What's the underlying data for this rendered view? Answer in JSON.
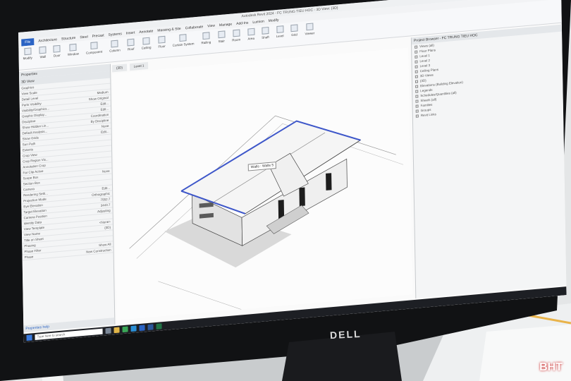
{
  "app": {
    "title": "Autodesk Revit 2024 - FC TRUNG TIEU HOC - 3D View: {3D}"
  },
  "menu": [
    "File",
    "Architecture",
    "Structure",
    "Steel",
    "Precast",
    "Systems",
    "Insert",
    "Annotate",
    "Massing & Site",
    "Collaborate",
    "View",
    "Manage",
    "Add-Ins",
    "Lumion",
    "Modify"
  ],
  "ribbon": [
    "Modify",
    "Wall",
    "Door",
    "Window",
    "Component",
    "Column",
    "Roof",
    "Ceiling",
    "Floor",
    "Curtain System",
    "Curtain Grid",
    "Mullion",
    "Railing",
    "Ramp",
    "Stair",
    "Model Text",
    "Model Line",
    "Model Group",
    "Room",
    "Room Separator",
    "Tag Room",
    "Area",
    "Area Boundary",
    "Tag Area",
    "By Face",
    "Shaft",
    "Wall",
    "Vertical",
    "Dormer",
    "Level",
    "Grid",
    "Set",
    "Show",
    "Ref Plane",
    "Viewer"
  ],
  "properties": {
    "header": "Properties",
    "type": "3D View",
    "rows": [
      [
        "Graphics",
        ""
      ],
      [
        "View Scale",
        ""
      ],
      [
        "Detail Level",
        "Medium"
      ],
      [
        "Parts Visibility",
        "Show Original"
      ],
      [
        "Visibility/Graphics...",
        "Edit..."
      ],
      [
        "Graphic Display...",
        "Edit..."
      ],
      [
        "Discipline",
        "Coordination"
      ],
      [
        "Show Hidden Lin...",
        "By Discipline"
      ],
      [
        "Default Analysis...",
        "None"
      ],
      [
        "Show Grids",
        "Edit..."
      ],
      [
        "Sun Path",
        ""
      ],
      [
        "Extents",
        ""
      ],
      [
        "Crop View",
        ""
      ],
      [
        "Crop Region Vis...",
        ""
      ],
      [
        "Annotation Crop",
        ""
      ],
      [
        "Far Clip Active",
        ""
      ],
      [
        "Scope Box",
        "None"
      ],
      [
        "Section Box",
        ""
      ],
      [
        "Camera",
        ""
      ],
      [
        "Rendering Setti...",
        "Edit..."
      ],
      [
        "Projection Mode",
        "Orthographic"
      ],
      [
        "Eye Elevation",
        "7552.7"
      ],
      [
        "Target Elevation",
        "3443.7"
      ],
      [
        "Camera Position",
        "Adjusting"
      ],
      [
        "Identity Data",
        ""
      ],
      [
        "View Template",
        "<None>"
      ],
      [
        "View Name",
        "{3D}"
      ],
      [
        "Title on Sheet",
        ""
      ],
      [
        "Phasing",
        ""
      ],
      [
        "Phase Filter",
        "Show All"
      ],
      [
        "Phase",
        "New Construction"
      ]
    ],
    "help": "Properties help"
  },
  "tabs": [
    "{3D}",
    "Level 1"
  ],
  "tooltip": "Walls : Walls 5",
  "browser": {
    "header": "Project Browser - FC TRUNG TIEU HOC",
    "items": [
      "Views (all)",
      "Floor Plans",
      "Level 1",
      "Level 2",
      "Level 3",
      "Ceiling Plans",
      "3D Views",
      "{3D}",
      "Elevations (Building Elevation)",
      "Legends",
      "Schedules/Quantities (all)",
      "Sheets (all)",
      "Families",
      "Groups",
      "Revit Links"
    ]
  },
  "status": "Walls : Walls 5",
  "taskbar": {
    "search": "Type here to search"
  },
  "monitor_brand": "DELL",
  "watermark": "BHT"
}
